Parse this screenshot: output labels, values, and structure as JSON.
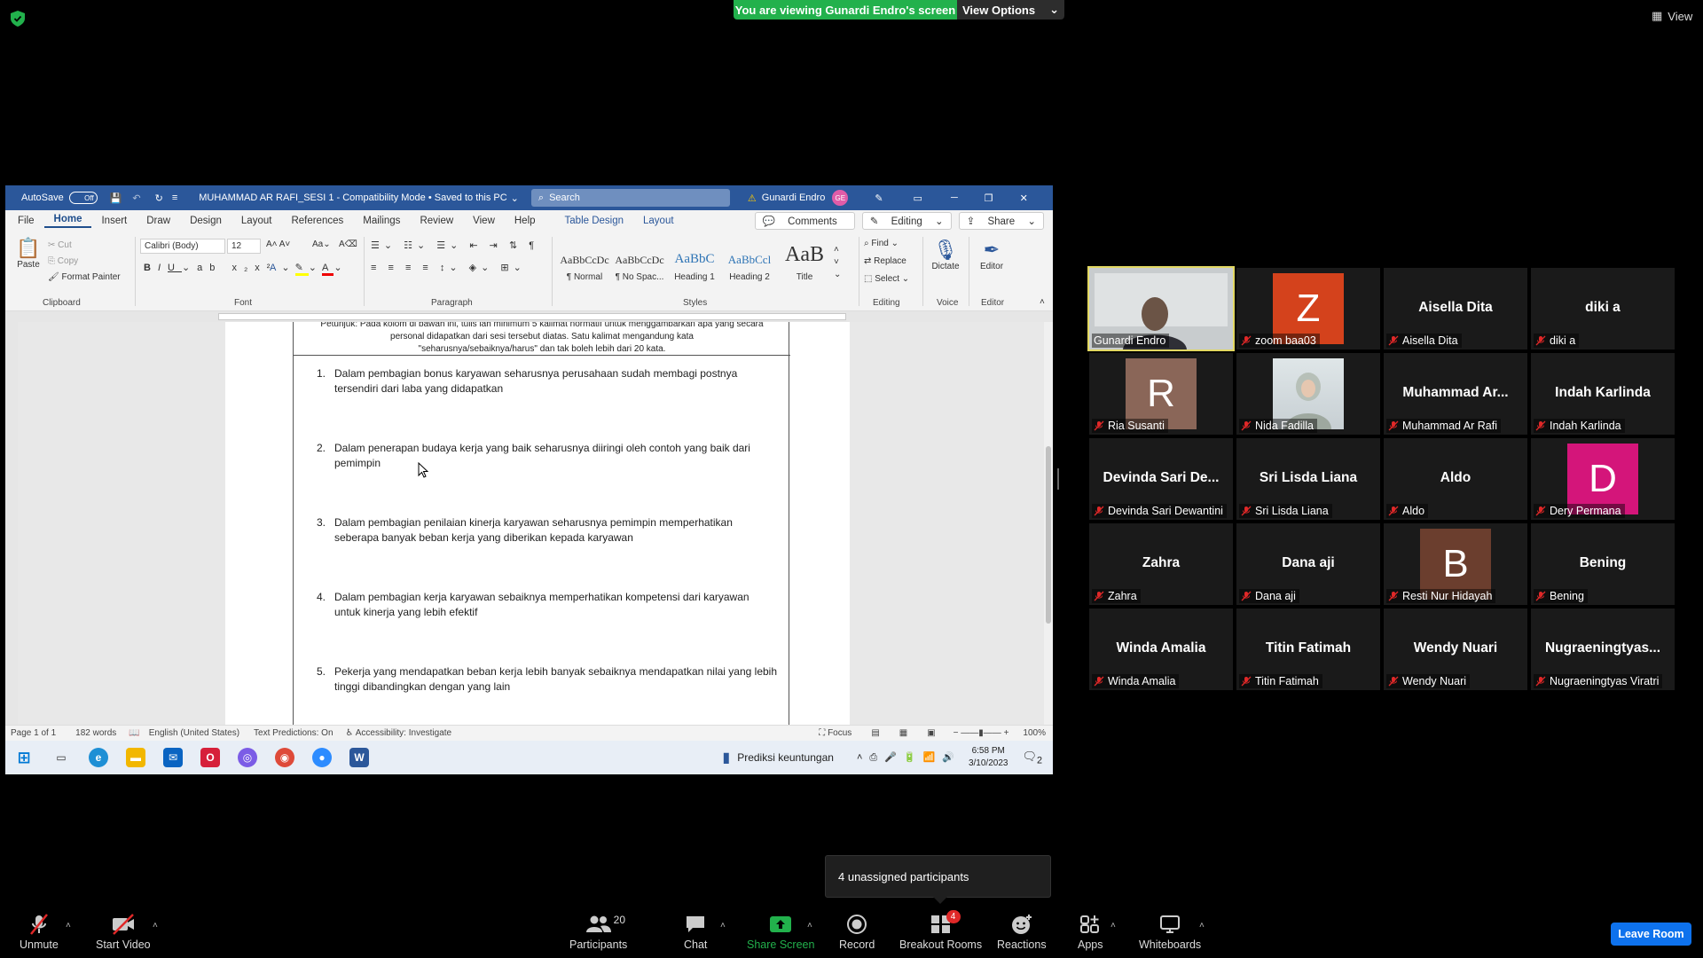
{
  "banner": {
    "viewing_text": "You are viewing Gunardi Endro's screen",
    "view_options": "View Options",
    "view_label": "View"
  },
  "word": {
    "autosave": "AutoSave",
    "autosave_state": "Off",
    "doc_title": "MUHAMMAD AR RAFI_SESI 1  -  Compatibility Mode  •  Saved to this PC",
    "search_placeholder": "Search",
    "user_name": "Gunardi Endro",
    "user_initials": "GE",
    "tabs": [
      "File",
      "Home",
      "Insert",
      "Draw",
      "Design",
      "Layout",
      "References",
      "Mailings",
      "Review",
      "View",
      "Help",
      "Table Design",
      "Layout"
    ],
    "comments": "Comments",
    "editing": "Editing",
    "share": "Share",
    "clipboard": {
      "paste": "Paste",
      "cut": "Cut",
      "copy": "Copy",
      "format_painter": "Format Painter",
      "label": "Clipboard"
    },
    "font": {
      "name": "Calibri (Body)",
      "size": "12",
      "label": "Font"
    },
    "paragraph_label": "Paragraph",
    "styles": [
      {
        "preview": "AaBbCcDc",
        "name": "¶ Normal"
      },
      {
        "preview": "AaBbCcDc",
        "name": "¶ No Spac..."
      },
      {
        "preview": "AaBbC",
        "name": "Heading 1"
      },
      {
        "preview": "AaBbCcl",
        "name": "Heading 2"
      },
      {
        "preview": "AaB",
        "name": "Title"
      }
    ],
    "styles_label": "Styles",
    "editing_group": {
      "find": "Find",
      "replace": "Replace",
      "select": "Select",
      "label": "Editing"
    },
    "voice": {
      "dictate": "Dictate",
      "label": "Voice"
    },
    "editor": {
      "editor": "Editor",
      "label": "Editor"
    },
    "doc_header": [
      "Petunjuk: Pada kolom di bawah ini, tulis lah minimum 5 kalimat normatif untuk menggambarkan apa yang secara",
      "personal didapatkan dari sesi tersebut diatas. Satu kalimat mengandung kata",
      "\"seharusnya/sebaiknya/harus\" dan tak boleh lebih dari 20 kata."
    ],
    "items": [
      {
        "num": "1.",
        "text": "Dalam pembagian bonus karyawan seharusnya perusahaan sudah membagi postnya tersendiri dari laba yang didapatkan"
      },
      {
        "num": "2.",
        "text": "Dalam penerapan budaya kerja yang baik seharusnya diiringi oleh contoh yang baik dari pemimpin"
      },
      {
        "num": "3.",
        "text": "Dalam pembagian penilaian kinerja karyawan seharusnya pemimpin memperhatikan seberapa banyak beban kerja yang diberikan kepada karyawan"
      },
      {
        "num": "4.",
        "text": "Dalam pembagian kerja karyawan sebaiknya memperhatikan kompetensi dari karyawan untuk kinerja yang lebih efektif"
      },
      {
        "num": "5.",
        "text": "Pekerja yang mendapatkan beban kerja lebih banyak sebaiknya mendapatkan nilai yang lebih tinggi dibandingkan dengan yang lain"
      }
    ],
    "status": {
      "page": "Page 1 of 1",
      "words": "182 words",
      "language": "English (United States)",
      "text_predictions": "Text Predictions: On",
      "accessibility": "Accessibility: Investigate",
      "focus": "Focus",
      "zoom": "100%"
    }
  },
  "taskbar": {
    "notification": "Prediksi keuntungan",
    "time": "6:58 PM",
    "date": "3/10/2023",
    "notif_count": "2"
  },
  "participants": [
    {
      "display": "",
      "name": "Gunardi Endro",
      "type": "video",
      "muted": false
    },
    {
      "display": "Z",
      "name": "zoom baa03",
      "type": "avatar",
      "color": "#d4421c",
      "muted": true
    },
    {
      "display": "Aisella Dita",
      "name": "Aisella Dita",
      "type": "text",
      "muted": true
    },
    {
      "display": "diki a",
      "name": "diki a",
      "type": "text",
      "muted": true
    },
    {
      "display": "R",
      "name": "Ria Susanti",
      "type": "avatar",
      "color": "#8a6658",
      "muted": true
    },
    {
      "display": "",
      "name": "Nida Fadilla",
      "type": "photo",
      "muted": true
    },
    {
      "display": "Muhammad Ar...",
      "name": "Muhammad Ar Rafi",
      "type": "text",
      "muted": true
    },
    {
      "display": "Indah Karlinda",
      "name": "Indah Karlinda",
      "type": "text",
      "muted": true
    },
    {
      "display": "Devinda Sari De...",
      "name": "Devinda Sari Dewantini",
      "type": "text",
      "muted": true
    },
    {
      "display": "Sri Lisda Liana",
      "name": "Sri Lisda Liana",
      "type": "text",
      "muted": true
    },
    {
      "display": "Aldo",
      "name": "Aldo",
      "type": "text",
      "muted": true
    },
    {
      "display": "D",
      "name": "Dery Permana",
      "type": "avatar",
      "color": "#d4157a",
      "muted": true
    },
    {
      "display": "Zahra",
      "name": "Zahra",
      "type": "text",
      "muted": true
    },
    {
      "display": "Dana aji",
      "name": "Dana aji",
      "type": "text",
      "muted": true
    },
    {
      "display": "B",
      "name": "Resti Nur Hidayah",
      "type": "avatar",
      "color": "#6b3e2e",
      "muted": true
    },
    {
      "display": "Bening",
      "name": "Bening",
      "type": "text",
      "muted": true
    },
    {
      "display": "Winda Amalia",
      "name": "Winda Amalia",
      "type": "text",
      "muted": true
    },
    {
      "display": "Titin Fatimah",
      "name": "Titin Fatimah",
      "type": "text",
      "muted": true
    },
    {
      "display": "Wendy Nuari",
      "name": "Wendy Nuari",
      "type": "text",
      "muted": true
    },
    {
      "display": "Nugraeningtyas...",
      "name": "Nugraeningtyas Viratri",
      "type": "text",
      "muted": true
    }
  ],
  "popover": {
    "unassigned": "4 unassigned participants"
  },
  "toolbar": {
    "unmute": "Unmute",
    "start_video": "Start Video",
    "participants": "Participants",
    "participants_count": "20",
    "chat": "Chat",
    "share_screen": "Share Screen",
    "record": "Record",
    "breakout_rooms": "Breakout Rooms",
    "breakout_badge": "4",
    "reactions": "Reactions",
    "apps": "Apps",
    "whiteboards": "Whiteboards",
    "leave": "Leave Room"
  },
  "colors": {
    "banner_green": "#22b14c",
    "word_blue": "#2b579a",
    "share_green": "#22b14c",
    "leave_blue": "#0e72ed",
    "active_speaker": "#e2d862",
    "muted_red": "#e02828"
  }
}
